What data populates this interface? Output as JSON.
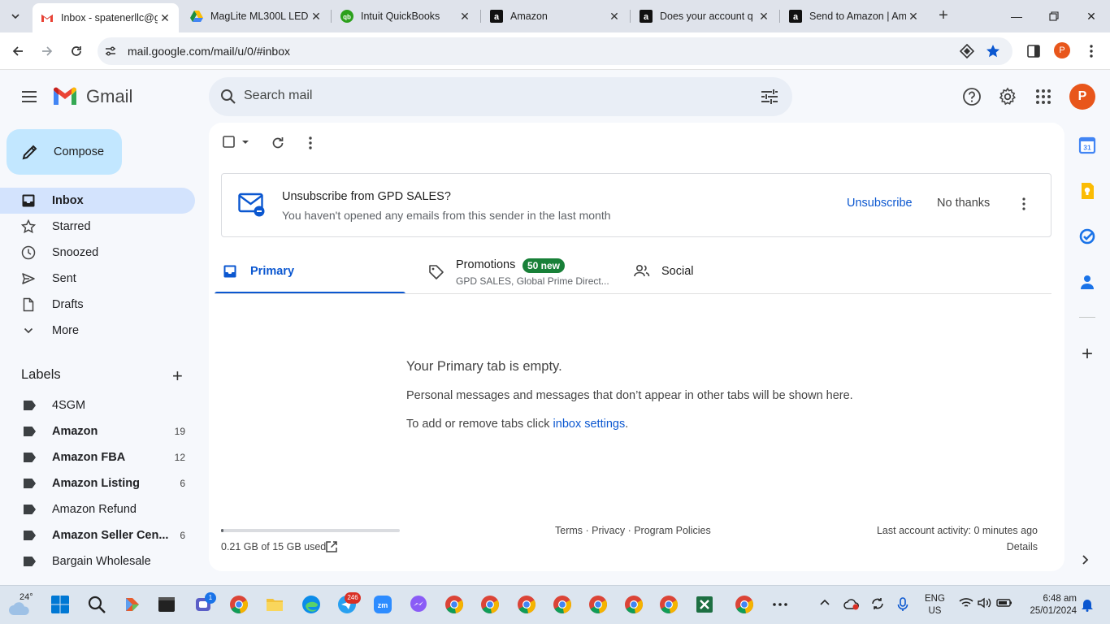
{
  "browser": {
    "tabs": [
      {
        "title": "Inbox - spatenerllc@g",
        "favicon": "gmail-icon",
        "active": true
      },
      {
        "title": "MagLite ML300L LED",
        "favicon": "google-drive-icon"
      },
      {
        "title": "Intuit QuickBooks",
        "favicon": "quickbooks-icon"
      },
      {
        "title": "Amazon",
        "favicon": "amazon-icon"
      },
      {
        "title": "Does your account q",
        "favicon": "amazon-icon"
      },
      {
        "title": "Send to Amazon | Am",
        "favicon": "amazon-icon"
      }
    ],
    "url": "mail.google.com/mail/u/0/#inbox",
    "profile_initial": "P"
  },
  "gmail": {
    "brand": "Gmail",
    "search_placeholder": "Search mail",
    "avatar_initial": "P",
    "compose_label": "Compose",
    "nav": [
      {
        "label": "Inbox",
        "icon": "inbox-icon",
        "active": true
      },
      {
        "label": "Starred",
        "icon": "star-icon"
      },
      {
        "label": "Snoozed",
        "icon": "clock-icon"
      },
      {
        "label": "Sent",
        "icon": "send-icon"
      },
      {
        "label": "Drafts",
        "icon": "draft-icon"
      },
      {
        "label": "More",
        "icon": "chevron-down-icon"
      }
    ],
    "labels_title": "Labels",
    "labels": [
      {
        "name": "4SGM",
        "count": "",
        "bold": false
      },
      {
        "name": "Amazon",
        "count": "19",
        "bold": true
      },
      {
        "name": "Amazon FBA",
        "count": "12",
        "bold": true
      },
      {
        "name": "Amazon Listing",
        "count": "6",
        "bold": true
      },
      {
        "name": "Amazon Refund",
        "count": "",
        "bold": false
      },
      {
        "name": "Amazon Seller Cen...",
        "count": "6",
        "bold": true
      },
      {
        "name": "Bargain Wholesale",
        "count": "",
        "bold": false
      }
    ],
    "unsubscribe": {
      "title": "Unsubscribe from GPD SALES?",
      "subtitle": "You haven't opened any emails from this sender in the last month",
      "unsubscribe_label": "Unsubscribe",
      "no_thanks_label": "No thanks"
    },
    "category_tabs": {
      "primary": "Primary",
      "promotions": "Promotions",
      "promotions_badge": "50 new",
      "promotions_sub": "GPD SALES, Global Prime Direct...",
      "social": "Social"
    },
    "empty": {
      "title": "Your Primary tab is empty.",
      "line1": "Personal messages and messages that don’t appear in other tabs will be shown here.",
      "line2_prefix": "To add or remove tabs click ",
      "line2_link": "inbox settings",
      "line2_suffix": "."
    },
    "footer": {
      "storage": "0.21 GB of 15 GB used",
      "storage_fraction": 0.014,
      "links": "Terms · Privacy · Program Policies",
      "last_activity": "Last account activity: 0 minutes ago",
      "details": "Details"
    }
  },
  "taskbar": {
    "temperature": "24°",
    "teams_badge": "1",
    "mail_badge": "246",
    "lang_line1": "ENG",
    "lang_line2": "US",
    "time": "6:48 am",
    "date": "25/01/2024"
  }
}
